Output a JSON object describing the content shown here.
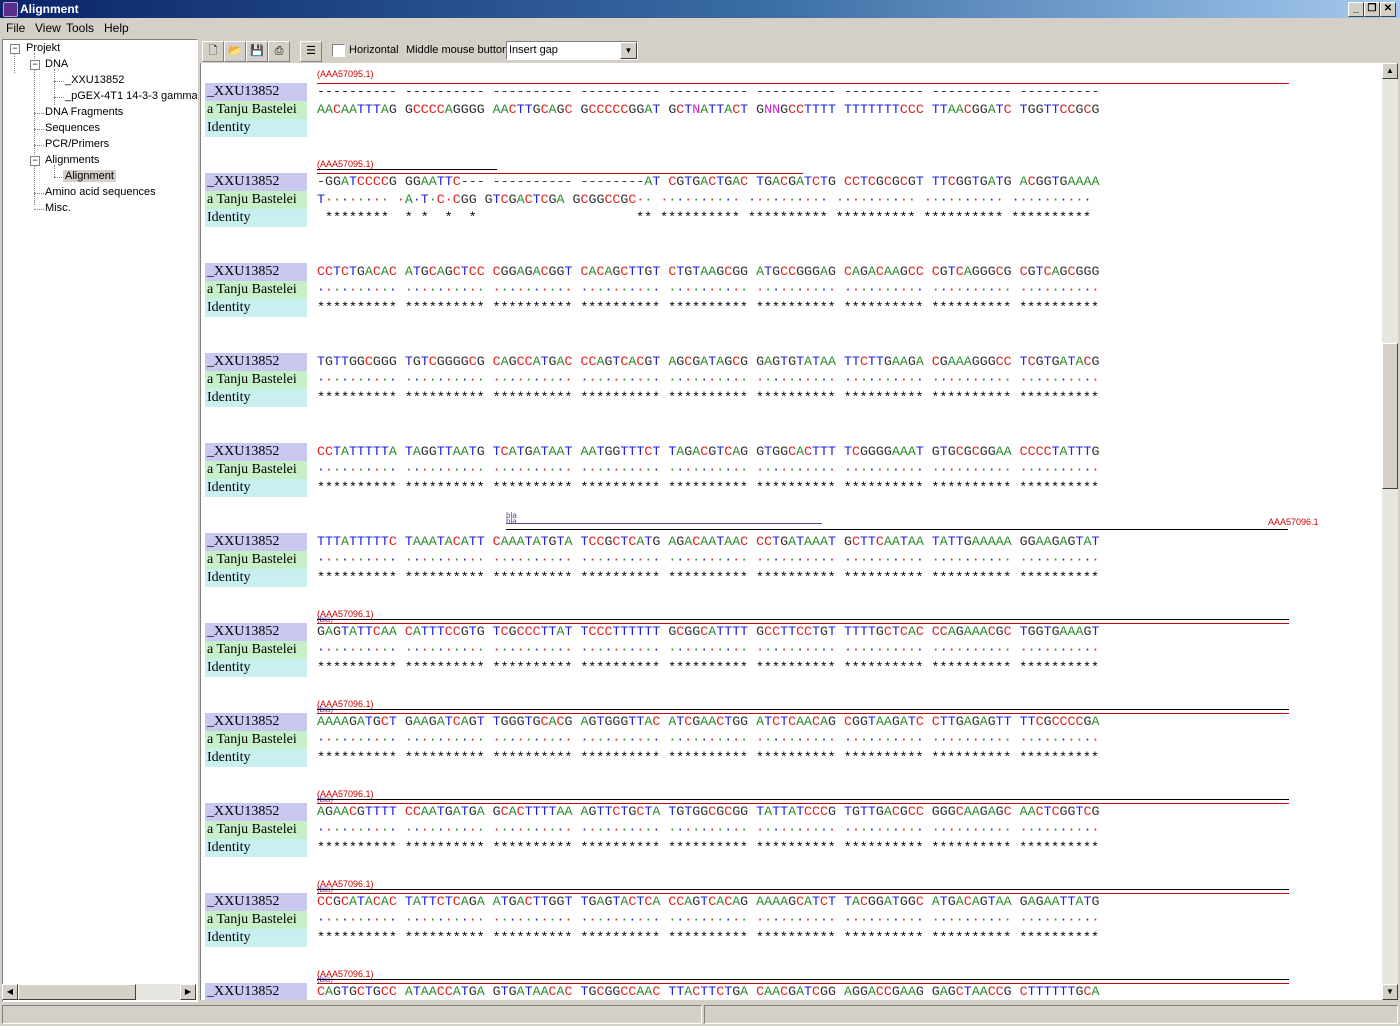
{
  "window": {
    "title": "Alignment"
  },
  "menu": [
    "File",
    "View",
    "Tools",
    "Help"
  ],
  "tree": {
    "root": "Projekt",
    "dna": "DNA",
    "dna_children": [
      "_XXU13852",
      "_pGEX-4T1 14-3-3 gamma"
    ],
    "dna_fragments": "DNA Fragments",
    "sequences": "Sequences",
    "pcr_primers": "PCR/Primers",
    "alignments": "Alignments",
    "alignment_item": "Alignment",
    "amino_acid": "Amino acid sequences",
    "misc": "Misc."
  },
  "toolbar": {
    "icons": [
      "new-icon",
      "open-icon",
      "save-icon",
      "print-icon",
      "list-icon"
    ],
    "horizontal_label": "Horizontal",
    "horizontal_checked": false,
    "middle_mouse_label": "Middle mouse button",
    "middle_mouse_value": "Insert gap"
  },
  "labels": {
    "seq": "_XXU13852",
    "cmp": "a Tanju Bastelei",
    "id": "Identity"
  },
  "colors": {
    "A": "#2a8a2a",
    "C": "#e02020",
    "G": "#303030",
    "T": "#2020e0",
    "N": "#d020d0",
    "gap": "#303030"
  },
  "features": {
    "aaa57095": "(AAA57095.1)",
    "aaa57096": "(AAA57096.1)",
    "aaa57096_end": "AAA57096.1",
    "bla": "bla",
    "bla_paren": "(bla)"
  },
  "blocks": [
    {
      "seq": "---------- ---------- ---------- ---------- ---------- ---------- ---------- ---------- ----------",
      "cmp": "AACAATTTAG GCCCCAGGGG AACTTGCAGC GCCCCCGGAT GCTNATTACT GNNGCCTTTT TTTTTTTCCC TTAACGGATC TGGTTCCGCG",
      "idn": ""
    },
    {
      "seq": "-GGATCCCCG GGAATTC--- ---------- --------AT CGTGACTGAC TGACGATCTG CCTCGCGCGT TTCGGTGATG ACGGTGAAAA",
      "cmp": "T········ ·A·T·C·CGG GTCGACTCGA GCGGCCGC·· ·········· ·········· ·········· ·········· ··········",
      "idn": " ********  * *  *  *                    ** ********** ********** ********** ********** **********"
    },
    {
      "seq": "CCTCTGACAC ATGCAGCTCC CGGAGACGGT CACAGCTTGT CTGTAAGCGG ATGCCGGGAG CAGACAAGCC CGTCAGGGCG CGTCAGCGGG",
      "cmp": "·········· ·········· ·········· ·········· ·········· ·········· ·········· ·········· ··········",
      "idn": "********** ********** ********** ********** ********** ********** ********** ********** **********"
    },
    {
      "seq": "TGTTGGCGGG TGTCGGGGCG CAGCCATGAC CCAGTCACGT AGCGATAGCG GAGTGTATAA TTCTTGAAGA CGAAAGGGCC TCGTGATACG",
      "cmp": "·········· ·········· ·········· ·········· ·········· ·········· ·········· ·········· ··········",
      "idn": "********** ********** ********** ********** ********** ********** ********** ********** **********"
    },
    {
      "seq": "CCTATTTTTA TAGGTTAATG TCATGATAAT AATGGTTTCT TAGACGTCAG GTGGCACTTT TCGGGGAAAT GTGCGCGGAA CCCCTATTTG",
      "cmp": "·········· ·········· ·········· ·········· ·········· ·········· ·········· ·········· ··········",
      "idn": "********** ********** ********** ********** ********** ********** ********** ********** **********"
    },
    {
      "seq": "TTTATTTTTC TAAATACATT CAAATATGTA TCCGCTCATG AGACAATAAC CCTGATAAAT GCTTCAATAA TATTGAAAAA GGAAGAGTAT",
      "cmp": "·········· ·········· ·········· ·········· ·········· ·········· ·········· ·········· ··········",
      "idn": "********** ********** ********** ********** ********** ********** ********** ********** **********"
    },
    {
      "seq": "GAGTATTCAA CATTTCCGTG TCGCCCTTAT TCCCTTTTTT GCGGCATTTT GCCTTCCTGT TTTTGCTCAC CCAGAAACGC TGGTGAAAGT",
      "cmp": "·········· ·········· ·········· ·········· ·········· ·········· ·········· ·········· ··········",
      "idn": "********** ********** ********** ********** ********** ********** ********** ********** **********"
    },
    {
      "seq": "AAAAGATGCT GAAGATCAGT TGGGTGCACG AGTGGGTTAC ATCGAACTGG ATCTCAACAG CGGTAAGATC CTTGAGAGTT TTCGCCCCGA",
      "cmp": "·········· ·········· ·········· ·········· ·········· ·········· ·········· ·········· ··········",
      "idn": "********** ********** ********** ********** ********** ********** ********** ********** **********"
    },
    {
      "seq": "AGAACGTTTT CCAATGATGA GCACTTTTAA AGTTCTGCTA TGTGGCGCGG TATTATCCCG TGTTGACGCC GGGCAAGAGC AACTCGGTCG",
      "cmp": "·········· ·········· ·········· ·········· ·········· ·········· ·········· ·········· ··········",
      "idn": "********** ********** ********** ********** ********** ********** ********** ********** **********"
    },
    {
      "seq": "CCGCATACAC TATTCTCAGA ATGACTTGGT TGAGTACTCA CCAGTCACAG AAAAGCATCT TACGGATGGC ATGACAGTAA GAGAATTATG",
      "cmp": "·········· ·········· ·········· ·········· ·········· ·········· ·········· ·········· ··········",
      "idn": "********** ********** ********** ********** ********** ********** ********** ********** **********"
    },
    {
      "seq": "CAGTGCTGCC ATAACCATGA GTGATAACAC TGCGGCCAAC TTACTTCTGA CAACGATCGG AGGACCGAAG GAGCTAACCG CTTTTTTGCA",
      "cmp": "",
      "idn": ""
    }
  ]
}
